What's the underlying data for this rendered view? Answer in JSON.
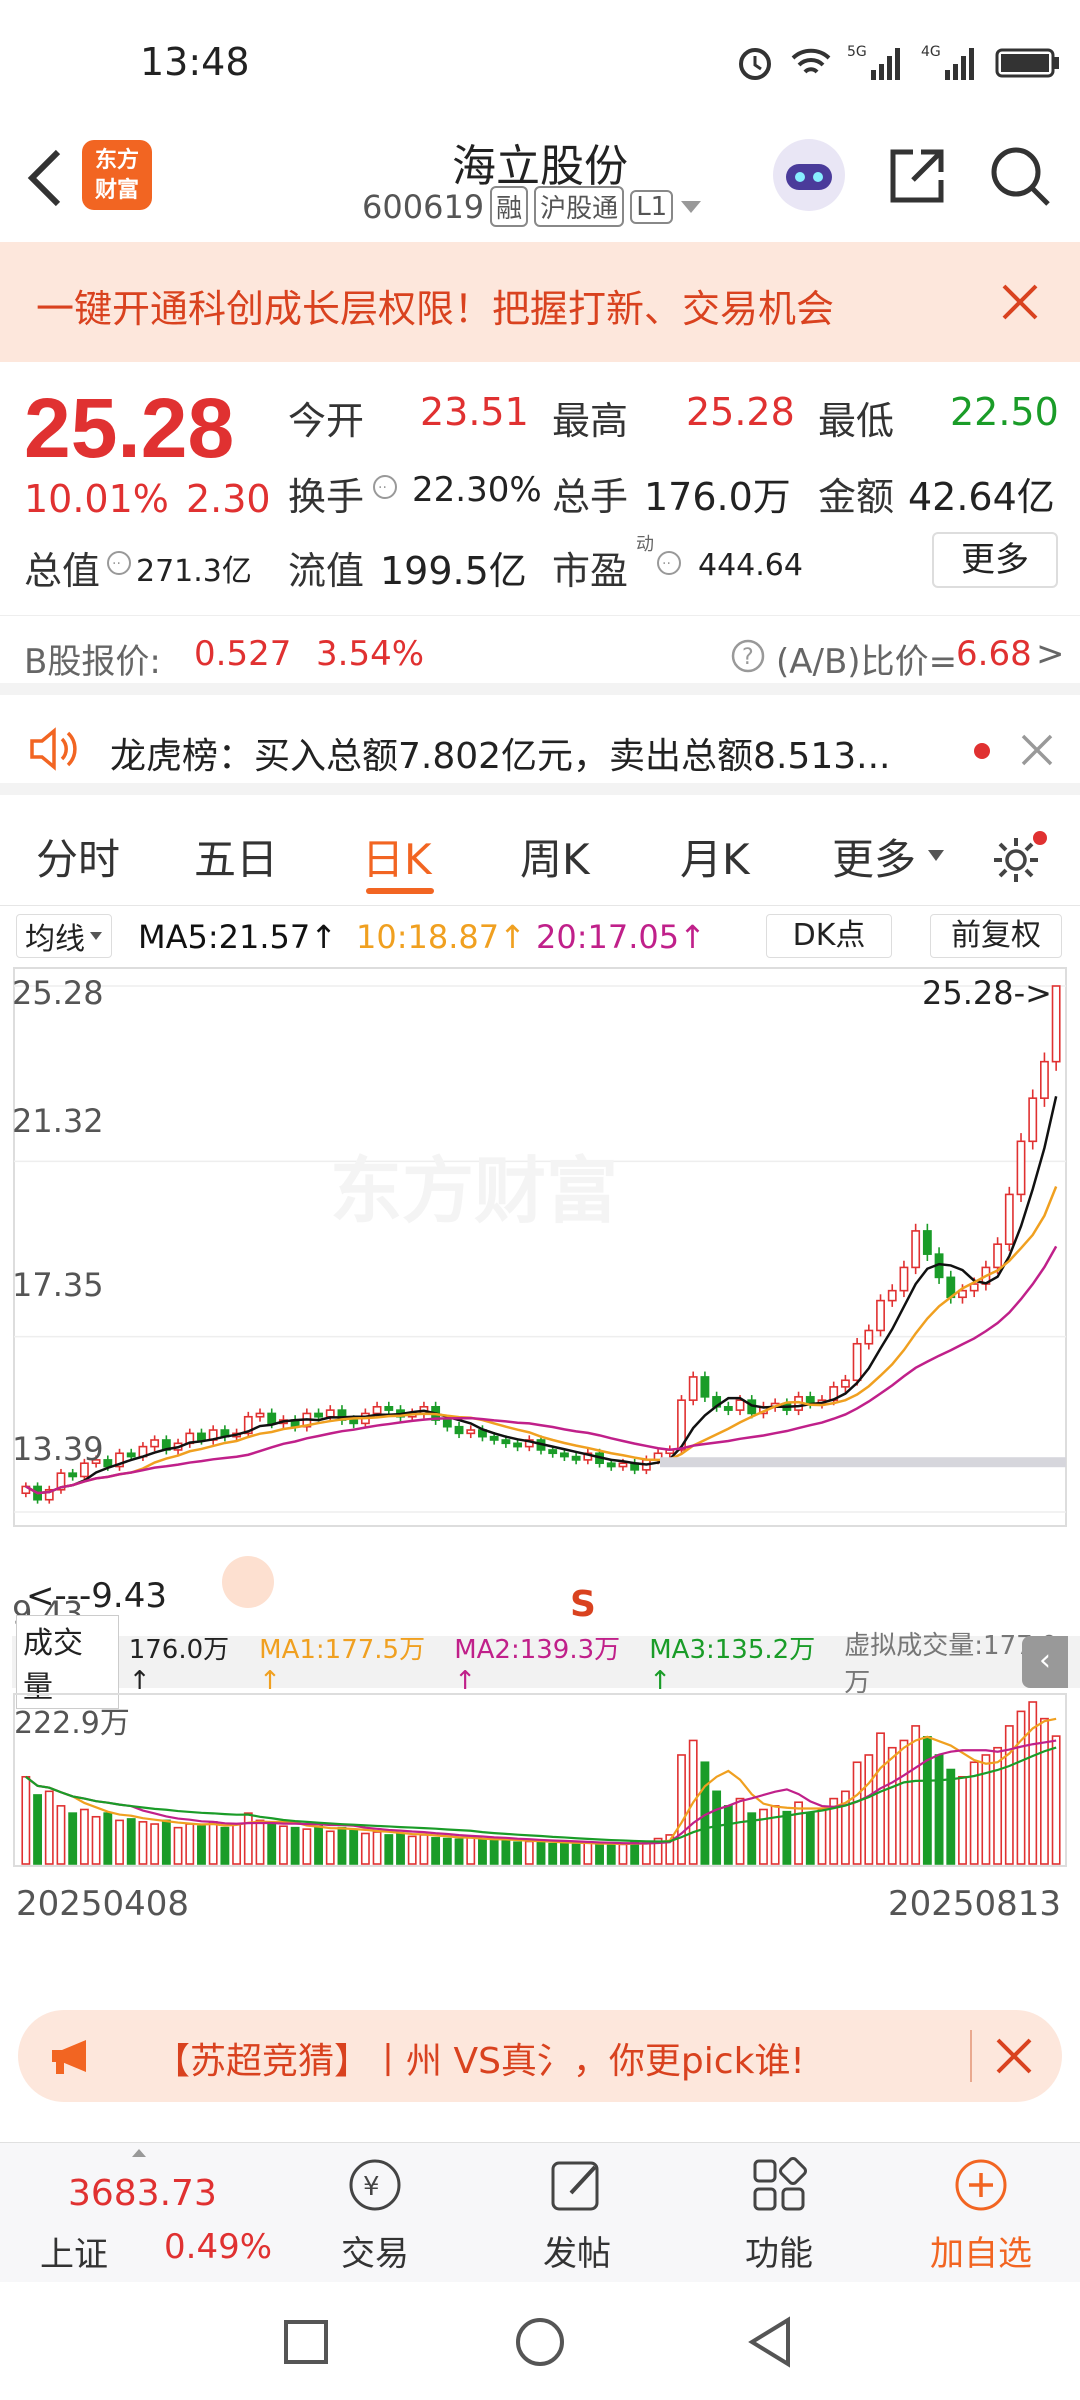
{
  "status": {
    "time": "13:48"
  },
  "header": {
    "stock_name": "海立股份",
    "code": "600619",
    "tags": [
      "融",
      "沪股通",
      "L1"
    ],
    "logo_line1": "东方",
    "logo_line2": "财富"
  },
  "promo": {
    "text": "一键开通科创成长层权限！把握打新、交易机会"
  },
  "quote": {
    "price": "25.28",
    "pct": "10.01%",
    "chg": "2.30",
    "open_label": "今开",
    "open": "23.51",
    "high_label": "最高",
    "high": "25.28",
    "low_label": "最低",
    "low": "22.50",
    "turnover_label": "换手",
    "turnover": "22.30%",
    "vol_label": "总手",
    "vol": "176.0万",
    "amount_label": "金额",
    "amount": "42.64亿",
    "mktcap_label": "总值",
    "mktcap": "271.3亿",
    "float_label": "流值",
    "float": "199.5亿",
    "pe_label": "市盈",
    "pe_sup": "动",
    "pe": "444.64",
    "more": "更多"
  },
  "bshare": {
    "label": "B股报价:",
    "price": "0.527",
    "pct": "3.54%",
    "ratio_label": "(A/B)比价=",
    "ratio": "6.68",
    "arrow": ">"
  },
  "lhb": {
    "text": "龙虎榜：买入总额7.802亿元，卖出总额8.513..."
  },
  "tabs": [
    "分时",
    "五日",
    "日K",
    "周K",
    "月K",
    "更多"
  ],
  "active_tab": "日K",
  "chart_head": {
    "ma_btn": "均线",
    "ma5": "MA5:21.57",
    "ma10": "10:18.87",
    "ma20": "20:17.05",
    "dk": "DK点",
    "fq": "前复权"
  },
  "colors": {
    "up": "#e03131",
    "down": "#1a9c28",
    "ma5": "#111111",
    "ma10": "#f0a020",
    "ma20": "#c0208a",
    "accent": "#f26522"
  },
  "chart_data": {
    "type": "candlestick",
    "y_ticks": [
      "25.28",
      "21.32",
      "17.35",
      "13.39",
      "9.43"
    ],
    "ylim": [
      9.43,
      25.28
    ],
    "max_label": "25.28->",
    "min_label": "<---9.43",
    "signal": "S",
    "x_start": "20250408",
    "x_end": "20250813",
    "volume_title": "成交量",
    "vol_value": "176.0万",
    "vol_ma1": "MA1:177.5万",
    "vol_ma2": "MA2:139.3万",
    "vol_ma3": "MA3:135.2万",
    "virtual_vol": "虚拟成交量:177.0万",
    "vol_max_label": "222.9万",
    "closes": [
      10.2,
      9.8,
      10.1,
      10.6,
      10.5,
      10.9,
      11.0,
      10.8,
      11.2,
      11.1,
      11.4,
      11.6,
      11.3,
      11.5,
      11.8,
      11.6,
      11.9,
      11.7,
      11.8,
      12.3,
      12.4,
      12.1,
      12.2,
      12.0,
      12.4,
      12.3,
      12.5,
      12.2,
      12.1,
      12.4,
      12.6,
      12.5,
      12.3,
      12.4,
      12.6,
      12.2,
      12.0,
      11.8,
      11.9,
      11.7,
      11.6,
      11.5,
      11.4,
      11.6,
      11.3,
      11.2,
      11.1,
      11.0,
      11.2,
      10.9,
      10.8,
      10.9,
      10.7,
      11.0,
      11.2,
      11.3,
      12.8,
      13.5,
      12.9,
      12.6,
      12.5,
      12.8,
      12.4,
      12.6,
      12.7,
      12.5,
      12.9,
      12.7,
      12.8,
      13.2,
      13.4,
      14.5,
      14.9,
      15.8,
      16.1,
      16.8,
      17.9,
      17.2,
      16.5,
      15.9,
      16.1,
      16.3,
      16.8,
      17.5,
      19.0,
      20.6,
      21.9,
      23.0,
      25.28
    ],
    "volumes": [
      120,
      95,
      100,
      80,
      70,
      75,
      65,
      70,
      60,
      62,
      58,
      55,
      60,
      50,
      55,
      52,
      58,
      50,
      54,
      70,
      60,
      55,
      52,
      50,
      48,
      52,
      45,
      50,
      46,
      42,
      44,
      40,
      42,
      38,
      40,
      36,
      35,
      34,
      36,
      33,
      32,
      34,
      30,
      31,
      30,
      28,
      30,
      27,
      29,
      26,
      28,
      27,
      30,
      29,
      35,
      40,
      150,
      170,
      140,
      100,
      80,
      90,
      70,
      75,
      80,
      72,
      85,
      70,
      75,
      90,
      100,
      140,
      150,
      180,
      160,
      170,
      190,
      175,
      150,
      130,
      120,
      140,
      150,
      160,
      190,
      210,
      222.9,
      200,
      176
    ]
  }
}
